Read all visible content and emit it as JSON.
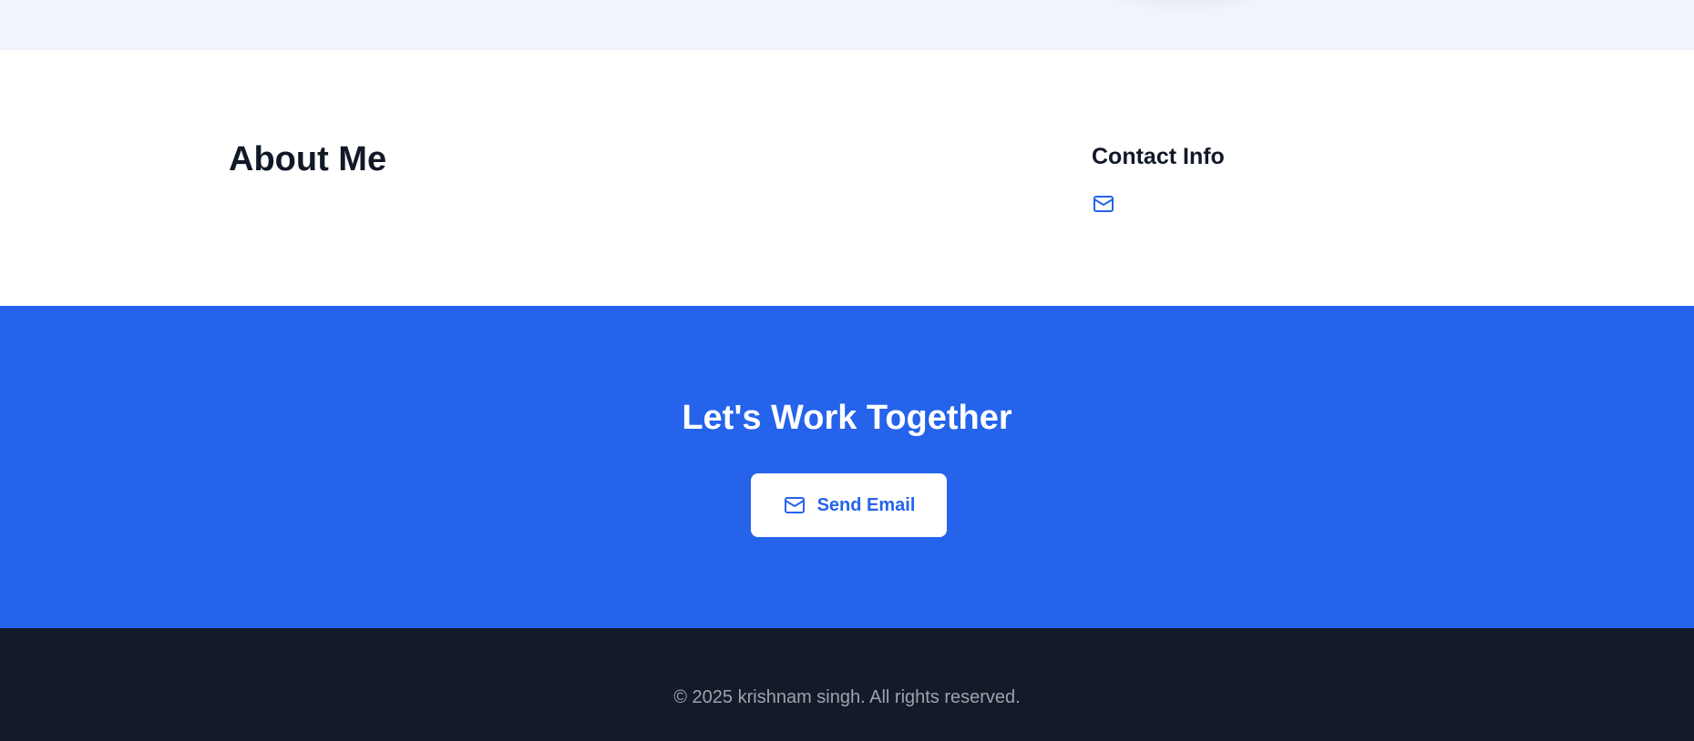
{
  "about": {
    "title": "About Me",
    "contact_title": "Contact Info",
    "contact_icon": "mail-icon"
  },
  "cta": {
    "title": "Let's Work Together",
    "button_label": "Send Email",
    "button_icon": "mail-icon"
  },
  "footer": {
    "copyright": "© 2025 krishnam singh. All rights reserved."
  },
  "colors": {
    "accent": "#2563eb",
    "heading": "#111827",
    "footer_bg": "#141a28",
    "footer_text": "#9ca3af",
    "top_strip_bg": "#f0f5fc"
  }
}
